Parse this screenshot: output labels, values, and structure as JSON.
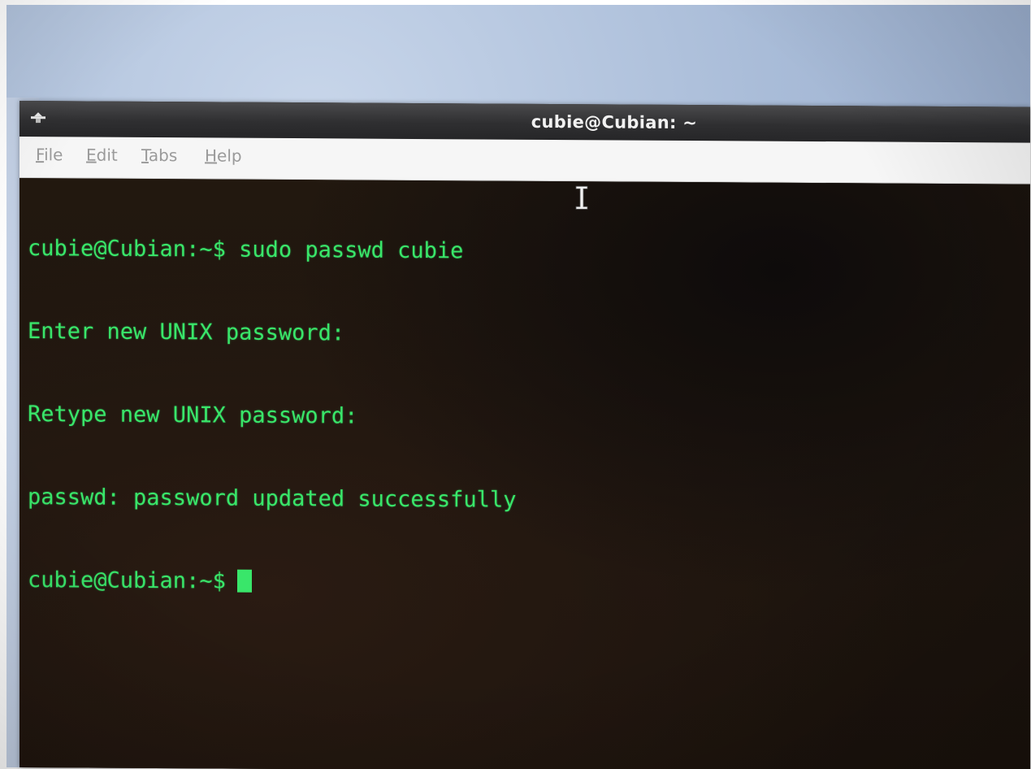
{
  "window": {
    "title": "cubie@Cubian: ~"
  },
  "menubar": {
    "items": [
      {
        "label": "File"
      },
      {
        "label": "Edit"
      },
      {
        "label": "Tabs"
      },
      {
        "label": "Help"
      }
    ]
  },
  "terminal": {
    "lines": [
      "cubie@Cubian:~$ sudo passwd cubie",
      "Enter new UNIX password:",
      "Retype new UNIX password:",
      "passwd: password updated successfully"
    ],
    "prompt": "cubie@Cubian:~$"
  },
  "colors": {
    "terminal_text": "#39e66a",
    "terminal_background": "#1c140e",
    "titlebar": "#2f2f31",
    "menubar": "#f6f6f6"
  },
  "icons": {
    "window_menu": "window-menu-icon",
    "text_cursor": "ibeam-cursor-icon"
  }
}
